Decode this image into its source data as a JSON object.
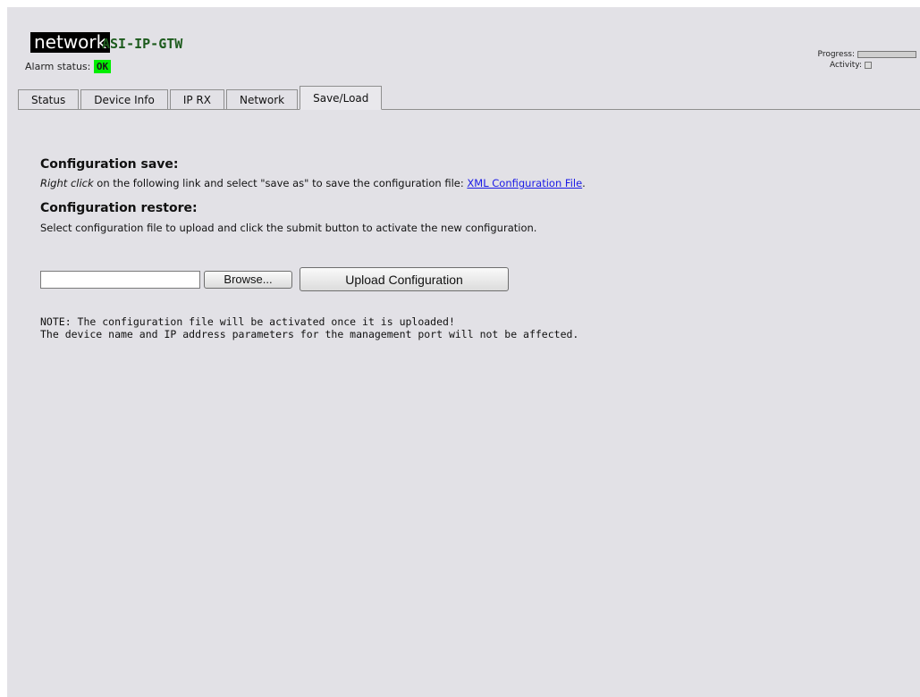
{
  "header": {
    "logo_text": "network",
    "device_name": "ASI-IP-GTW",
    "alarm_label": "Alarm status:",
    "alarm_value": "OK",
    "alarm_color": "#00ee00",
    "progress_label": "Progress:",
    "activity_label": "Activity:",
    "progress_value": 0
  },
  "tabs": [
    {
      "label": "Status",
      "active": false
    },
    {
      "label": "Device Info",
      "active": false
    },
    {
      "label": "IP RX",
      "active": false
    },
    {
      "label": "Network",
      "active": false
    },
    {
      "label": "Save/Load",
      "active": true
    }
  ],
  "save": {
    "title": "Configuration save:",
    "instruction_emphasis": "Right click",
    "instruction_text": " on the following link and select \"save as\" to save the configuration file: ",
    "link_label": "XML Configuration File",
    "link_suffix": "."
  },
  "restore": {
    "title": "Configuration restore:",
    "instruction": "Select configuration file to upload and click the submit button to activate the new configuration.",
    "file_value": "",
    "browse_label": "Browse...",
    "upload_label": "Upload Configuration"
  },
  "notes": {
    "line1": "NOTE: The configuration file will be activated once it is uploaded!",
    "line2": "The device name and IP address parameters for the management port will not be affected."
  },
  "colors": {
    "page_bg": "#e2e1e6",
    "link": "#1a1ae6",
    "device_name": "#1d5b1d"
  }
}
